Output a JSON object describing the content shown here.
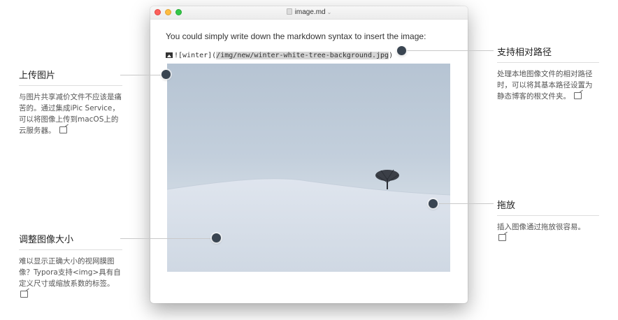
{
  "window": {
    "filename": "image.md",
    "intro_text": "You could simply write down the markdown syntax to insert the image:",
    "markdown_prefix": "![winter](",
    "markdown_path": "/img/new/winter-white-tree-background.jpg",
    "markdown_suffix": ")"
  },
  "annotations": {
    "upload": {
      "title": "上传图片",
      "body": "与图片共享减价文件不应该是痛苦的。通过集成iPic Service，可以将图像上传到macOS上的云服务器。"
    },
    "resize": {
      "title": "调整图像大小",
      "body": "难以显示正确大小的视网膜图像？Typora支持<img>具有自定义尺寸或缩放系数的标签。"
    },
    "relative_path": {
      "title": "支持相对路径",
      "body": "处理本地图像文件的相对路径时，可以将其基本路径设置为静态博客的根文件夹。"
    },
    "drag_drop": {
      "title": "拖放",
      "body": "插入图像通过拖放很容易。"
    }
  },
  "icons": {
    "title_doc": "document-icon",
    "title_caret": "chevron-down-icon",
    "image_glyph": "image-icon",
    "share": "share-icon"
  },
  "colors": {
    "dot": "#3a4551",
    "close": "#fc605c",
    "minimize": "#fdbc40",
    "maximize": "#34c749"
  }
}
